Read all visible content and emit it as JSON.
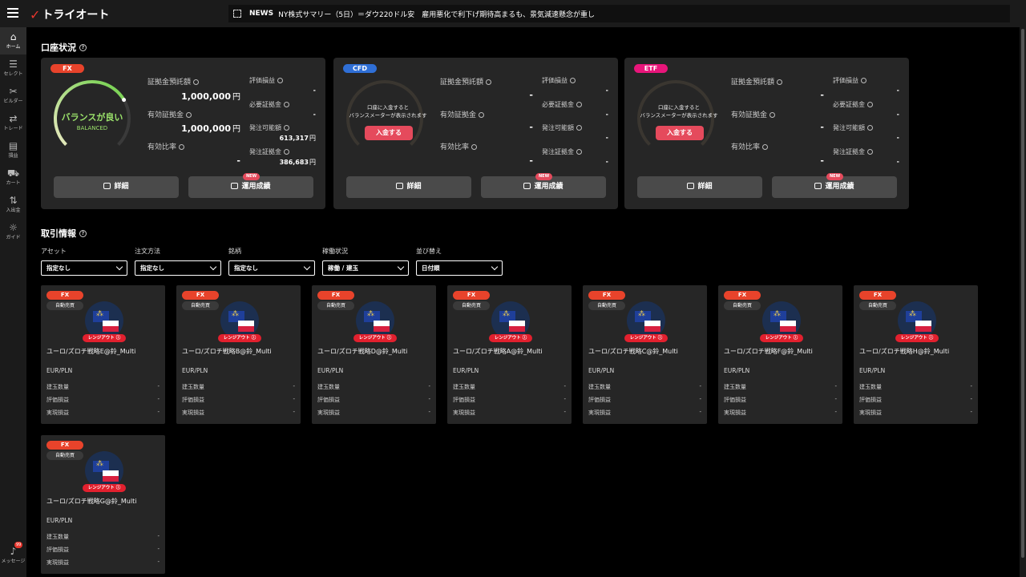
{
  "app": {
    "logo_mark": "✓",
    "logo_text": "トライオート"
  },
  "news": {
    "tag": "NEWS",
    "text": "NY株式サマリー（5日）＝ダウ220ドル安　雇用悪化で利下げ期待高まるも、景気減速懸念が重し"
  },
  "sidebar": {
    "items": [
      {
        "label": "ホーム",
        "icon": "home-icon",
        "glyph": "⌂"
      },
      {
        "label": "セレクト",
        "icon": "select-icon",
        "glyph": "☰"
      },
      {
        "label": "ビルダー",
        "icon": "builder-icon",
        "glyph": "✂"
      },
      {
        "label": "トレード",
        "icon": "trade-icon",
        "glyph": "⇄"
      },
      {
        "label": "損益",
        "icon": "pnl-icon",
        "glyph": "▤"
      },
      {
        "label": "カート",
        "icon": "cart-icon",
        "glyph": "⛟"
      },
      {
        "label": "入出金",
        "icon": "transfer-icon",
        "glyph": "⇅"
      },
      {
        "label": "ガイド",
        "icon": "guide-icon",
        "glyph": "☼"
      }
    ],
    "message": {
      "label": "メッセージ",
      "badge": "99",
      "glyph": "♪"
    }
  },
  "account_section": {
    "title": "口座状況"
  },
  "accounts": [
    {
      "type": "FX",
      "color": "#e8432b",
      "gauge_label": "バランスが良い",
      "gauge_sub": "BALANCED",
      "gauge_level": 0.72,
      "deposit_margin_label": "証拠金預託額",
      "deposit_margin_value": "1,000,000",
      "deposit_margin_unit": "円",
      "effective_margin_label": "有効証拠金",
      "effective_margin_value": "1,000,000",
      "effective_margin_unit": "円",
      "effective_ratio_label": "有効比率",
      "effective_ratio_value": "-",
      "unrealized_label": "評価損益",
      "unrealized_value": "-",
      "required_label": "必要証拠金",
      "required_value": "-",
      "orderable_label": "発注可能額",
      "orderable_value": "613,317",
      "orderable_unit": "円",
      "order_margin_label": "発注証拠金",
      "order_margin_value": "386,683",
      "order_margin_unit": "円",
      "detail_btn": "詳細",
      "performance_btn": "運用成績",
      "new_badge": "NEW"
    },
    {
      "type": "CFD",
      "color": "#2f6fd6",
      "gauge_msg_1": "口座に入金すると",
      "gauge_msg_2": "バランスメーターが表示されます",
      "deposit_btn": "入金する",
      "deposit_margin_label": "証拠金預託額",
      "deposit_margin_value": "-",
      "effective_margin_label": "有効証拠金",
      "effective_margin_value": "-",
      "effective_ratio_label": "有効比率",
      "effective_ratio_value": "-",
      "unrealized_label": "評価損益",
      "unrealized_value": "-",
      "required_label": "必要証拠金",
      "required_value": "-",
      "orderable_label": "発注可能額",
      "orderable_value": "-",
      "order_margin_label": "発注証拠金",
      "order_margin_value": "-",
      "detail_btn": "詳細",
      "performance_btn": "運用成績",
      "new_badge": "NEW"
    },
    {
      "type": "ETF",
      "color": "#e8157a",
      "gauge_msg_1": "口座に入金すると",
      "gauge_msg_2": "バランスメーターが表示されます",
      "deposit_btn": "入金する",
      "deposit_margin_label": "証拠金預託額",
      "deposit_margin_value": "-",
      "effective_margin_label": "有効証拠金",
      "effective_margin_value": "-",
      "effective_ratio_label": "有効比率",
      "effective_ratio_value": "-",
      "unrealized_label": "評価損益",
      "unrealized_value": "-",
      "required_label": "必要証拠金",
      "required_value": "-",
      "orderable_label": "発注可能額",
      "orderable_value": "-",
      "order_margin_label": "発注証拠金",
      "order_margin_value": "-",
      "detail_btn": "詳細",
      "performance_btn": "運用成績",
      "new_badge": "NEW"
    }
  ],
  "trade_section": {
    "title": "取引情報"
  },
  "filters": [
    {
      "label": "アセット",
      "value": "指定なし"
    },
    {
      "label": "注文方法",
      "value": "指定なし"
    },
    {
      "label": "銘柄",
      "value": "指定なし"
    },
    {
      "label": "稼働状況",
      "value": "稼働 / 建玉"
    },
    {
      "label": "並び替え",
      "value": "日付順"
    }
  ],
  "card_labels": {
    "asset": "FX",
    "mode": "自動売買",
    "range": "レンジアウト",
    "pair": "EUR/PLN",
    "positions": "建玉数量",
    "unrealized": "評価損益",
    "realized": "実現損益",
    "empty": "-"
  },
  "cards": [
    {
      "name": "ユーロ/ズロチ戦略E@鈴_Multi"
    },
    {
      "name": "ユーロ/ズロチ戦略B@鈴_Multi"
    },
    {
      "name": "ユーロ/ズロチ戦略D@鈴_Multi"
    },
    {
      "name": "ユーロ/ズロチ戦略A@鈴_Multi"
    },
    {
      "name": "ユーロ/ズロチ戦略C@鈴_Multi"
    },
    {
      "name": "ユーロ/ズロチ戦略F@鈴_Multi"
    },
    {
      "name": "ユーロ/ズロチ戦略H@鈴_Multi"
    },
    {
      "name": "ユーロ/ズロチ戦略G@鈴_Multi"
    }
  ]
}
